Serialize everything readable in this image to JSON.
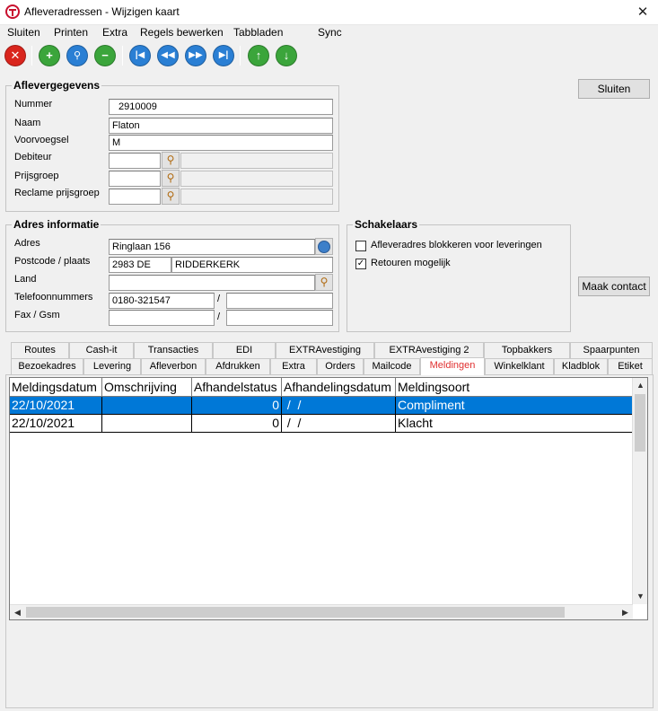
{
  "window": {
    "title": "Afleveradressen - Wijzigen kaart",
    "close": "✕"
  },
  "menu": [
    "Sluiten",
    "Printen",
    "Extra",
    "Regels bewerken",
    "Tabbladen",
    "Sync"
  ],
  "toolbar": {
    "buttons": [
      {
        "name": "delete",
        "glyph": "✕",
        "color": "#d9251d"
      },
      {
        "name": "add",
        "glyph": "+",
        "color": "#3ba53b"
      },
      {
        "name": "search",
        "glyph": "🔍",
        "color": "#2a7fd4"
      },
      {
        "name": "minus",
        "glyph": "−",
        "color": "#3ba53b"
      },
      {
        "name": "first",
        "glyph": "⏮",
        "color": "#2a7fd4"
      },
      {
        "name": "prev",
        "glyph": "⏪",
        "color": "#2a7fd4"
      },
      {
        "name": "next",
        "glyph": "⏩",
        "color": "#2a7fd4"
      },
      {
        "name": "last",
        "glyph": "⏭",
        "color": "#2a7fd4"
      },
      {
        "name": "up",
        "glyph": "↑",
        "color": "#3ba53b"
      },
      {
        "name": "down",
        "glyph": "↓",
        "color": "#3ba53b"
      }
    ]
  },
  "aflevergegevens": {
    "title": "Aflevergegevens",
    "labels": {
      "nummer": "Nummer",
      "naam": "Naam",
      "voorvoegsel": "Voorvoegsel",
      "debiteur": "Debiteur",
      "prijsgroep": "Prijsgroep",
      "reclame": "Reclame prijsgroep"
    },
    "values": {
      "nummer": "2910009",
      "naam": "Flaton",
      "voorvoegsel": "M",
      "debiteur": "",
      "prijsgroep": "",
      "reclame": ""
    }
  },
  "adres": {
    "title": "Adres informatie",
    "labels": {
      "adres": "Adres",
      "postcode": "Postcode / plaats",
      "land": "Land",
      "telefoon": "Telefoonnummers",
      "fax": "Fax / Gsm"
    },
    "values": {
      "adres": "Ringlaan 156",
      "postcode": "2983 DE",
      "plaats": "RIDDERKERK",
      "land": "",
      "telefoon1": "0180-321547",
      "telefoon2": "",
      "fax": "",
      "gsm": ""
    },
    "separator": "/"
  },
  "schakelaars": {
    "title": "Schakelaars",
    "options": [
      {
        "label": "Afleveradres blokkeren voor leveringen",
        "checked": false,
        "mark": ""
      },
      {
        "label": "Retouren mogelijk",
        "checked": true,
        "mark": "✓"
      }
    ]
  },
  "buttons": {
    "sluiten": "Sluiten",
    "maak_contact": "Maak contact"
  },
  "tabs_row1": [
    "Routes",
    "Cash-it",
    "Transacties",
    "EDI",
    "EXTRAvestiging",
    "EXTRAvestiging 2",
    "Topbakkers",
    "Spaarpunten"
  ],
  "tabs_row2": [
    "Bezoekadres",
    "Levering",
    "Afleverbon",
    "Afdrukken",
    "Extra",
    "Orders",
    "Mailcode",
    "Meldingen",
    "Winkelklant",
    "Kladblok",
    "Etiket"
  ],
  "active_tab": "Meldingen",
  "grid": {
    "columns": [
      "Meldingsdatum",
      "Omschrijving",
      "Afhandelstatus",
      "Afhandelingsdatum",
      "Meldingsoort"
    ],
    "rows": [
      {
        "datum": "22/10/2021",
        "omschrijving": "",
        "status": "0",
        "afhandelingsdatum": " /  /",
        "soort": "Compliment",
        "selected": true
      },
      {
        "datum": "22/10/2021",
        "omschrijving": "",
        "status": "0",
        "afhandelingsdatum": " /  /",
        "soort": "Klacht",
        "selected": false
      }
    ]
  },
  "colors": {
    "selection": "#0078d7",
    "active_tab_text": "#e03030"
  }
}
